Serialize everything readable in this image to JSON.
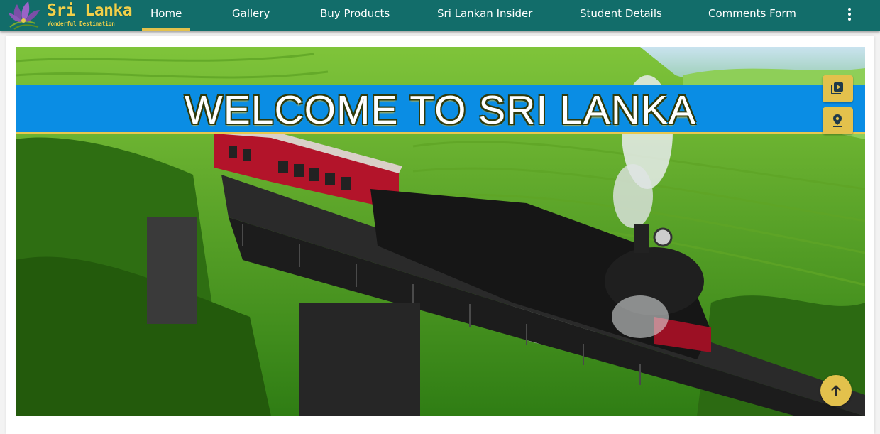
{
  "brand": {
    "title": "Sri Lanka",
    "tagline": "Wonderful Destination",
    "icon": "lotus-flower-logo",
    "color": "#f0d04a"
  },
  "nav": {
    "items": [
      {
        "label": "Home",
        "active": true
      },
      {
        "label": "Gallery",
        "active": false
      },
      {
        "label": "Buy Products",
        "active": false
      },
      {
        "label": "Sri Lankan Insider",
        "active": false
      },
      {
        "label": "Student Details",
        "active": false
      },
      {
        "label": "Comments Form",
        "active": false
      }
    ],
    "more_icon": "more-vertical-icon",
    "bar_color": "#126d6a",
    "active_indicator_color": "#e3c14c"
  },
  "hero": {
    "banner_text": "WELCOME TO SRI LANKA",
    "banner_color": "#0a8de4",
    "image": "steam train crossing a bridge through green tea plantations"
  },
  "side_buttons": [
    {
      "icon": "video-library-icon"
    },
    {
      "icon": "map-pin-icon"
    }
  ],
  "scroll_top": {
    "icon": "arrow-up-icon"
  },
  "accent": "#e3c14c"
}
